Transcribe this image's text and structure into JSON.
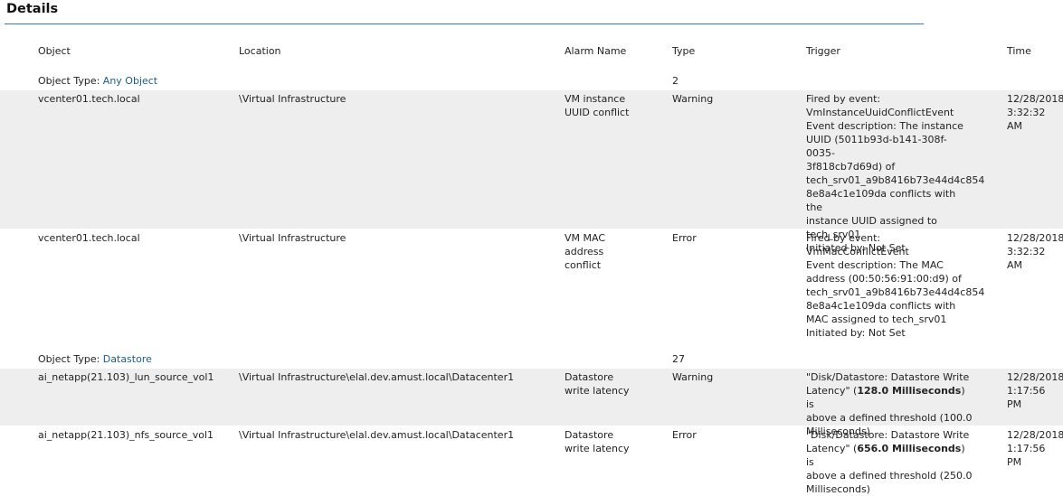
{
  "section_title": "Details",
  "columns": {
    "object": "Object",
    "location": "Location",
    "alarm_name": "Alarm Name",
    "type": "Type",
    "trigger": "Trigger",
    "time": "Time"
  },
  "groups": [
    {
      "label": "Object Type:",
      "value": "Any Object",
      "count": "2",
      "rows": [
        {
          "object": "vcenter01.tech.local",
          "location": "\\Virtual Infrastructure",
          "alarm_name": "VM instance\nUUID conflict",
          "type": "Warning",
          "trigger": "Fired by event:\nVmInstanceUuidConflictEvent\nEvent description: The instance\nUUID (5011b93d-b141-308f-0035-\n3f818cb7d69d) of\ntech_srv01_a9b8416b73e44d4c854\n8e8a4c1e109da conflicts with the\ninstance UUID assigned to\ntech_srv01\nInitiated by: Not Set",
          "time": "12/28/2018\n3:32:32 AM"
        },
        {
          "object": "vcenter01.tech.local",
          "location": "\\Virtual Infrastructure",
          "alarm_name": "VM MAC\naddress\nconflict",
          "type": "Error",
          "trigger": "Fired by event:\nVmMacConflictEvent\nEvent description: The MAC\naddress (00:50:56:91:00:d9) of\ntech_srv01_a9b8416b73e44d4c854\n8e8a4c1e109da conflicts with\nMAC assigned to tech_srv01\nInitiated by: Not Set",
          "time": "12/28/2018\n3:32:32 AM"
        }
      ]
    },
    {
      "label": "Object Type:",
      "value": "Datastore",
      "count": "27",
      "rows": [
        {
          "object": "ai_netapp(21.103)_lun_source_vol1",
          "location": "\\Virtual Infrastructure\\elal.dev.amust.local\\Datacenter1",
          "alarm_name": "Datastore\nwrite latency",
          "type": "Warning",
          "trigger_pre": "\"Disk/Datastore: Datastore Write\nLatency\" (",
          "trigger_bold": "128.0 Milliseconds",
          "trigger_post": ") is\nabove a defined threshold (100.0\nMilliseconds)",
          "time": "12/28/2018\n1:17:56 PM"
        },
        {
          "object": "ai_netapp(21.103)_nfs_source_vol1",
          "location": "\\Virtual Infrastructure\\elal.dev.amust.local\\Datacenter1",
          "alarm_name": "Datastore\nwrite latency",
          "type": "Error",
          "trigger_pre": "\"Disk/Datastore: Datastore Write\nLatency\" (",
          "trigger_bold": "656.0 Milliseconds",
          "trigger_post": ") is\nabove a defined threshold (250.0\nMilliseconds)",
          "time": "12/28/2018\n1:17:56 PM"
        }
      ]
    }
  ]
}
